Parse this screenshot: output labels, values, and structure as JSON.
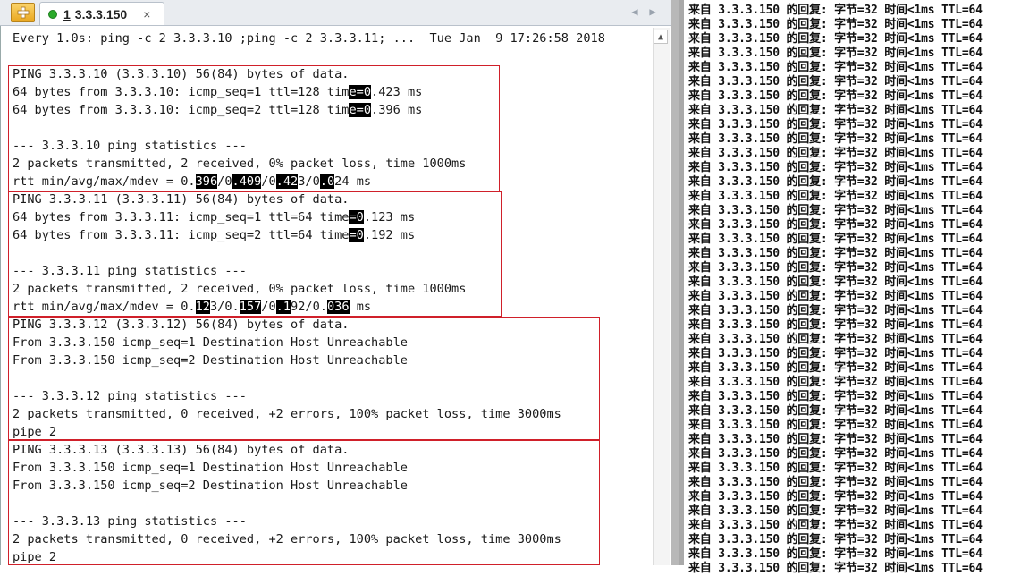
{
  "tab": {
    "index": "1",
    "title": "3.3.3.150",
    "close": "×"
  },
  "terminal": {
    "header": "Every 1.0s: ping -c 2 3.3.3.10 ;ping -c 2 3.3.3.11; ...  Tue Jan  9 17:26:58 2018",
    "lines": [
      {
        "text": "PING 3.3.3.10 (3.3.3.10) 56(84) bytes of data.",
        "hl": []
      },
      {
        "text": "64 bytes from 3.3.3.10: icmp_seq=1 ttl=128 time=0.423 ms",
        "hl": [
          [
            46,
            48
          ]
        ]
      },
      {
        "text": "64 bytes from 3.3.3.10: icmp_seq=2 ttl=128 time=0.396 ms",
        "hl": [
          [
            46,
            48
          ]
        ]
      },
      {
        "text": "",
        "hl": []
      },
      {
        "text": "--- 3.3.3.10 ping statistics ---",
        "hl": []
      },
      {
        "text": "2 packets transmitted, 2 received, 0% packet loss, time 1000ms",
        "hl": []
      },
      {
        "text": "rtt min/avg/max/mdev = 0.396/0.409/0.423/0.024 ms",
        "hl": [
          [
            25,
            27
          ],
          [
            30,
            33
          ],
          [
            36,
            38
          ],
          [
            42,
            43
          ]
        ]
      },
      {
        "text": "PING 3.3.3.11 (3.3.3.11) 56(84) bytes of data.",
        "hl": []
      },
      {
        "text": "64 bytes from 3.3.3.11: icmp_seq=1 ttl=64 time=0.123 ms",
        "hl": [
          [
            46,
            47
          ]
        ]
      },
      {
        "text": "64 bytes from 3.3.3.11: icmp_seq=2 ttl=64 time=0.192 ms",
        "hl": [
          [
            46,
            47
          ]
        ]
      },
      {
        "text": "",
        "hl": []
      },
      {
        "text": "--- 3.3.3.11 ping statistics ---",
        "hl": []
      },
      {
        "text": "2 packets transmitted, 2 received, 0% packet loss, time 1000ms",
        "hl": []
      },
      {
        "text": "rtt min/avg/max/mdev = 0.123/0.157/0.192/0.036 ms",
        "hl": [
          [
            25,
            26
          ],
          [
            31,
            33
          ],
          [
            36,
            37
          ],
          [
            43,
            45
          ]
        ]
      },
      {
        "text": "PING 3.3.3.12 (3.3.3.12) 56(84) bytes of data.",
        "hl": []
      },
      {
        "text": "From 3.3.3.150 icmp_seq=1 Destination Host Unreachable",
        "hl": []
      },
      {
        "text": "From 3.3.3.150 icmp_seq=2 Destination Host Unreachable",
        "hl": []
      },
      {
        "text": "",
        "hl": []
      },
      {
        "text": "--- 3.3.3.12 ping statistics ---",
        "hl": []
      },
      {
        "text": "2 packets transmitted, 0 received, +2 errors, 100% packet loss, time 3000ms",
        "hl": []
      },
      {
        "text": "pipe 2",
        "hl": []
      },
      {
        "text": "PING 3.3.3.13 (3.3.3.13) 56(84) bytes of data.",
        "hl": []
      },
      {
        "text": "From 3.3.3.150 icmp_seq=1 Destination Host Unreachable",
        "hl": []
      },
      {
        "text": "From 3.3.3.150 icmp_seq=2 Destination Host Unreachable",
        "hl": []
      },
      {
        "text": "",
        "hl": []
      },
      {
        "text": "--- 3.3.3.13 ping statistics ---",
        "hl": []
      },
      {
        "text": "2 packets transmitted, 0 received, +2 errors, 100% packet loss, time 3000ms",
        "hl": []
      },
      {
        "text": "pipe 2",
        "hl": []
      }
    ]
  },
  "console": {
    "line_text": "来自 3.3.3.150 的回复: 字节=32 时间<1ms TTL=64",
    "line_count": 40
  },
  "colors": {
    "highlight_box": "#d0202a",
    "tab_status": "#2aaa2a"
  },
  "icons": {
    "new_tab": "plus-icon",
    "scroll_up": "scroll-up-icon",
    "close": "close-icon"
  }
}
